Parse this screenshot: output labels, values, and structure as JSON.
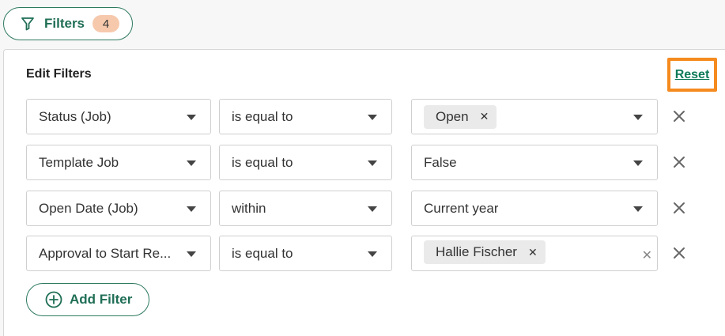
{
  "toolbar": {
    "filters_label": "Filters",
    "filters_count": "4"
  },
  "panel": {
    "title": "Edit Filters",
    "reset_label": "Reset",
    "add_filter_label": "Add Filter"
  },
  "filters": [
    {
      "field": "Status (Job)",
      "operator": "is equal to",
      "value_chip": "Open",
      "value_text": ""
    },
    {
      "field": "Template Job",
      "operator": "is equal to",
      "value_chip": "",
      "value_text": "False"
    },
    {
      "field": "Open Date (Job)",
      "operator": "within",
      "value_chip": "",
      "value_text": "Current year"
    },
    {
      "field": "Approval to Start Re...",
      "operator": "is equal to",
      "value_chip": "Hallie Fischer",
      "value_text": ""
    }
  ],
  "icons": {
    "filter": "funnel-icon",
    "dropdown": "caret-down-icon",
    "remove": "close-icon",
    "add": "plus-circle-icon"
  },
  "colors": {
    "accent": "#1f6e55",
    "highlight": "#f58a1f",
    "badge": "#f6c9ad"
  }
}
